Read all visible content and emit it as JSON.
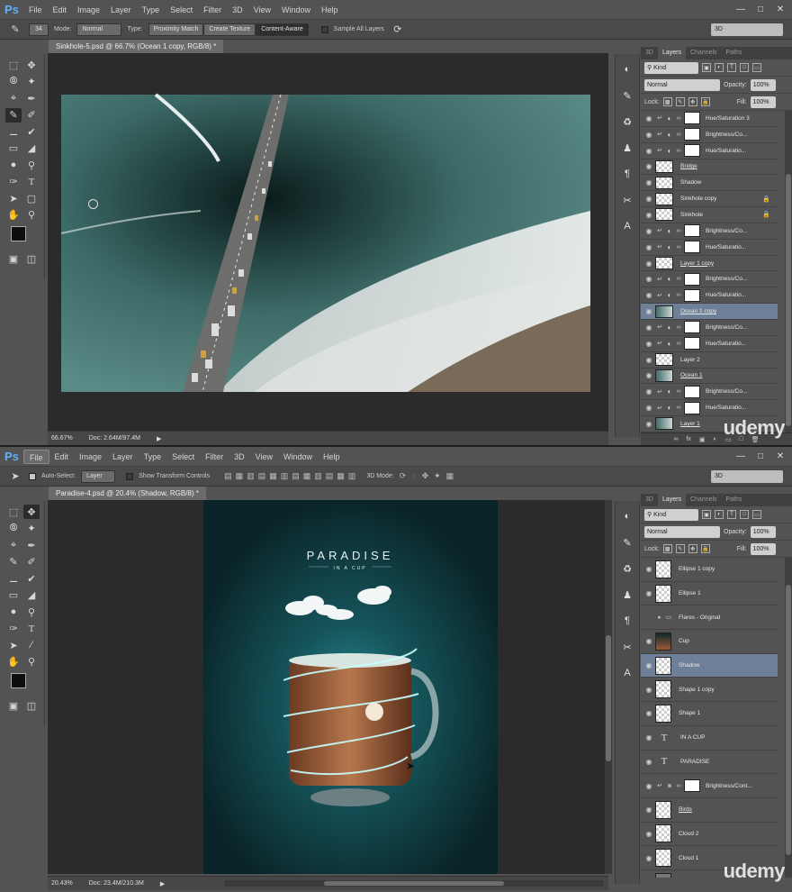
{
  "app_logo": "Ps",
  "watermark": "udemy",
  "window1": {
    "menu": [
      "File",
      "Edit",
      "Image",
      "Layer",
      "Type",
      "Select",
      "Filter",
      "3D",
      "View",
      "Window",
      "Help"
    ],
    "options": {
      "brush_size": "34",
      "mode_label": "Mode:",
      "mode_value": "Normal",
      "type_label": "Type:",
      "type_buttons": [
        "Proximity Match",
        "Create Texture",
        "Content-Aware"
      ],
      "sample_all_layers": "Sample All Layers",
      "workspace": "3D"
    },
    "doc_tab": "Sinkhole-5.psd @ 66.7% (Ocean 1 copy, RGB/8) *",
    "status": {
      "zoom": "66.67%",
      "doc": "Doc: 2.64M/97.4M"
    },
    "panel": {
      "tabs": [
        "3D",
        "Layers",
        "Channels",
        "Paths"
      ],
      "kind": "Kind",
      "blend": "Normal",
      "opacity_label": "Opacity:",
      "opacity": "100%",
      "lock_label": "Lock:",
      "fill_label": "Fill:",
      "fill": "100%",
      "layers": [
        {
          "name": "Hue/Saturation 3",
          "type": "adj"
        },
        {
          "name": "Brightness/Co...",
          "type": "adj"
        },
        {
          "name": "Hue/Saturatio...",
          "type": "adj"
        },
        {
          "name": "Bridge",
          "type": "img",
          "u": true
        },
        {
          "name": "Shadow",
          "type": "img"
        },
        {
          "name": "Sinkhole copy",
          "type": "img",
          "lock": true
        },
        {
          "name": "Sinkhole",
          "type": "img",
          "lock": true
        },
        {
          "name": "Brightness/Co...",
          "type": "adj"
        },
        {
          "name": "Hue/Saturatio...",
          "type": "adj"
        },
        {
          "name": "Layer 1 copy",
          "type": "img",
          "u": true
        },
        {
          "name": "Brightness/Co...",
          "type": "adj"
        },
        {
          "name": "Hue/Saturatio...",
          "type": "adj"
        },
        {
          "name": "Ocean 1 copy",
          "type": "ocean",
          "u": true,
          "sel": true
        },
        {
          "name": "Brightness/Co...",
          "type": "adj"
        },
        {
          "name": "Hue/Saturatio...",
          "type": "adj"
        },
        {
          "name": "Layer 2",
          "type": "img"
        },
        {
          "name": "Ocean 1",
          "type": "ocean",
          "u": true
        },
        {
          "name": "Brightness/Co...",
          "type": "adj"
        },
        {
          "name": "Hue/Saturatio...",
          "type": "adj"
        },
        {
          "name": "Layer 1",
          "type": "ocean",
          "u": true
        }
      ]
    }
  },
  "window2": {
    "menu": [
      "File",
      "Edit",
      "Image",
      "Layer",
      "Type",
      "Select",
      "Filter",
      "3D",
      "View",
      "Window",
      "Help"
    ],
    "options": {
      "auto_select": "Auto-Select:",
      "auto_select_value": "Layer",
      "transform_controls": "Show Transform Controls",
      "mode_3d": "3D Mode:",
      "workspace": "3D"
    },
    "doc_tab": "Paradise-4.psd @ 20.4% (Shadow, RGB/8) *",
    "poster_title": "PARADISE",
    "poster_subtitle": "IN A CUP",
    "status": {
      "zoom": "20.43%",
      "doc": "Doc: 23.4M/210.3M"
    },
    "panel": {
      "tabs": [
        "3D",
        "Layers",
        "Channels",
        "Paths"
      ],
      "kind": "Kind",
      "blend": "Normal",
      "opacity_label": "Opacity:",
      "opacity": "100%",
      "lock_label": "Lock:",
      "fill_label": "Fill:",
      "fill": "100%",
      "layers": [
        {
          "name": "Ellipse 1 copy",
          "type": "img"
        },
        {
          "name": "Ellipse 1",
          "type": "img"
        },
        {
          "name": "Flares - Original",
          "type": "folder",
          "hidden": true
        },
        {
          "name": "Cup",
          "type": "cup"
        },
        {
          "name": "Shadow",
          "type": "img",
          "sel": true
        },
        {
          "name": "Shape 1 copy",
          "type": "shape"
        },
        {
          "name": "Shape 1",
          "type": "shape"
        },
        {
          "name": "IN A CUP",
          "type": "text"
        },
        {
          "name": "PARADISE",
          "type": "text"
        },
        {
          "name": "Brightness/Cont...",
          "type": "adj2"
        },
        {
          "name": "Birds",
          "type": "img",
          "u": true
        },
        {
          "name": "Cloud 2",
          "type": "img"
        },
        {
          "name": "Cloud 1",
          "type": "img"
        },
        {
          "name": "Glow Clouds",
          "type": "glow"
        }
      ]
    }
  }
}
